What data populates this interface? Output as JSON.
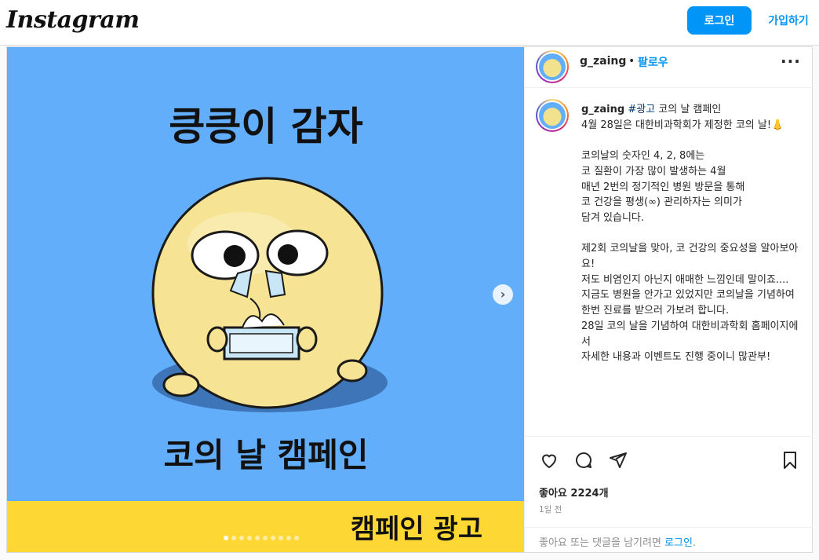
{
  "header": {
    "logo": "Instagram",
    "login_label": "로그인",
    "signup_label": "가입하기"
  },
  "media": {
    "title_top": "킁킁이 감자",
    "title_bottom": "코의 날 캠페인",
    "banner": "캠페인 광고",
    "slide_count": 10,
    "active_slide": 1,
    "next_icon": "chevron-right-icon"
  },
  "side": {
    "username": "g_zaing",
    "bullet": "•",
    "follow_label": "팔로우",
    "more_icon": "ellipsis-icon",
    "caption": {
      "username": "g_zaing",
      "hashtag": "#광고",
      "text": " 코의 날 캠페인\n4월 28일은 대한비과학회가 제정한 코의 날!👃\n\n코의날의 숫자인 4, 2, 8에는\n코 질환이 가장 많이 발생하는 4월\n매년 2번의 정기적인 병원 방문을 통해\n코 건강을 평생(∞) 관리하자는 의미가\n담겨 있습니다.\n\n제2회 코의날을 맞아, 코 건강의 중요성을 알아보아요!\n저도 비염인지 아닌지 애매한 느낌인데 말이죠....\n지금도 병원을 안가고 있었지만 코의날을 기념하여\n한번 진료를 받으러 가보려 합니다.\n28일 코의 날을 기념하여 대한비과학회 홈페이지에서\n자세한 내용과 이벤트도 진행 중이니 많관부!"
    },
    "likes": "좋아요 2224개",
    "time": "1일 전",
    "footer_text": "좋아요 또는 댓글을 남기려면 ",
    "footer_link": "로그인",
    "footer_end": "."
  },
  "colors": {
    "accent": "#0095f6",
    "media_bg": "#63aefb",
    "banner_bg": "#fdd835"
  }
}
